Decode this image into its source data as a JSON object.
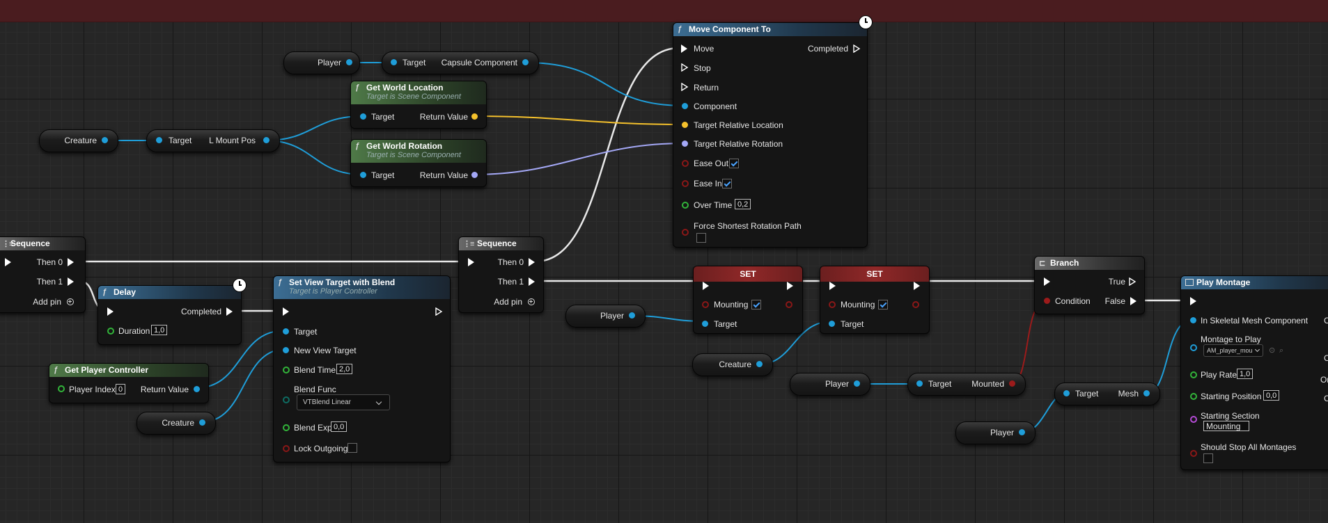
{
  "graph": {
    "background_color": "#262626",
    "top_band_color": "#4a1c1f"
  },
  "pin_colors": {
    "exec": "#ffffff",
    "object": "#1f9ed9",
    "vector": "#f5c12c",
    "rotator": "#a4a8f6",
    "float": "#32b53a",
    "boolean": "#9c1b1b",
    "string": "#b54bd6"
  },
  "icons": {
    "function": "function-icon",
    "latent": "clock-icon",
    "sequence": "sequence-icon",
    "branch": "branch-icon",
    "montage": "montage-icon",
    "add_pin": "plus-circle-icon"
  },
  "vars": {
    "player": "Player",
    "creature": "Creature"
  },
  "common": {
    "target": "Target",
    "return_value": "Return Value",
    "add_pin": "Add pin",
    "then0": "Then 0",
    "then1": "Then 1",
    "set": "SET",
    "mounting": "Mounting"
  },
  "capsule_get": {
    "label": "Capsule Component"
  },
  "mount_pos_get": {
    "label": "L Mount Pos"
  },
  "mounted_get": {
    "label": "Mounted"
  },
  "mesh_get": {
    "label": "Mesh"
  },
  "get_world_location": {
    "title": "Get World Location",
    "subtitle": "Target is Scene Component"
  },
  "get_world_rotation": {
    "title": "Get World Rotation",
    "subtitle": "Target is Scene Component"
  },
  "move_component_to": {
    "title": "Move Component To",
    "pins": {
      "move": "Move",
      "stop": "Stop",
      "return": "Return",
      "component": "Component",
      "target_rel_location": "Target Relative Location",
      "target_rel_rotation": "Target Relative Rotation",
      "ease_out": "Ease Out",
      "ease_in": "Ease In",
      "over_time": "Over Time",
      "force_shortest": "Force Shortest Rotation Path",
      "completed": "Completed"
    },
    "values": {
      "over_time": "0,2",
      "ease_out": true,
      "ease_in": true,
      "force_shortest": false
    }
  },
  "sequence": {
    "title": "Sequence"
  },
  "delay": {
    "title": "Delay",
    "completed": "Completed",
    "duration_label": "Duration",
    "duration": "1,0"
  },
  "set_view_target": {
    "title": "Set View Target with Blend",
    "subtitle": "Target is Player Controller",
    "pins": {
      "target": "Target",
      "new_view_target": "New View Target",
      "blend_time": "Blend Time",
      "blend_func": "Blend Func",
      "blend_exp": "Blend Exp",
      "lock_outgoing": "Lock Outgoing"
    },
    "values": {
      "blend_time": "2,0",
      "blend_func": "VTBlend Linear",
      "blend_exp": "0,0",
      "lock_outgoing": false
    }
  },
  "get_player_controller": {
    "title": "Get Player Controller",
    "player_index_label": "Player Index",
    "player_index": "0",
    "return_value": "Return Value"
  },
  "branch": {
    "title": "Branch",
    "true": "True",
    "false": "False",
    "condition": "Condition"
  },
  "play_montage": {
    "title": "Play Montage",
    "pins": {
      "skeletal_mesh": "In Skeletal Mesh Component",
      "montage": "Montage to Play",
      "play_rate": "Play Rate",
      "starting_position": "Starting Position",
      "starting_section": "Starting Section",
      "should_stop": "Should Stop All Montages"
    },
    "values": {
      "montage": "AM_player_mou",
      "play_rate": "1,0",
      "starting_position": "0,0",
      "starting_section": "Mounting"
    },
    "cut_labels": {
      "c1": "C",
      "c2": "C",
      "o": "Or",
      "c3": "C"
    }
  }
}
